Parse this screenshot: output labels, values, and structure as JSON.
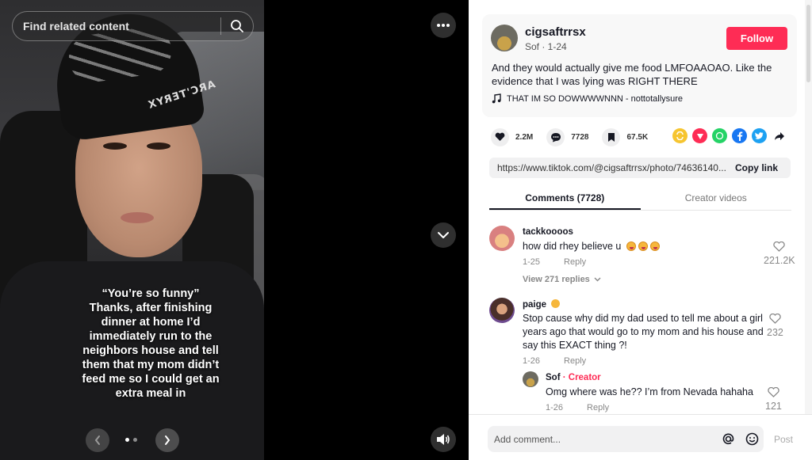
{
  "search": {
    "placeholder": "Find related content"
  },
  "caption": "“You’re so funny”\nThanks, after finishing dinner at home I’d immediately run to the neighbors house and tell them that my mom didn’t feed me so I could get an extra meal in",
  "photo": {
    "brand_text": "ARC'TERYX"
  },
  "carousel": {
    "slide_count": 2,
    "current_slide": 1
  },
  "post": {
    "username": "cigsaftrrsx",
    "display_sub": "Sof · 1-24",
    "follow_label": "Follow",
    "description": "And they would actually give me food LMFOAAOAO. Like the evidence that I was lying was RIGHT THERE",
    "music": "THAT IM SO DOWWWWNNN - nottotallysure"
  },
  "stats": {
    "likes": "2.2M",
    "comments": "7728",
    "saves": "67.5K"
  },
  "share_icons": [
    "repost-icon",
    "send-icon",
    "whatsapp-icon",
    "facebook-icon",
    "twitter-icon",
    "share-arrow-icon"
  ],
  "link": {
    "url": "https://www.tiktok.com/@cigsaftrrsx/photo/74636140...",
    "copy_label": "Copy link"
  },
  "tabs": [
    {
      "label": "Comments (7728)",
      "active": true
    },
    {
      "label": "Creator videos",
      "active": false
    }
  ],
  "comments": [
    {
      "user": "tackkoooos",
      "text": "how did rhey believe u",
      "date": "1-25",
      "reply": "Reply",
      "likes": "221.2K",
      "view_replies": "View 271 replies"
    },
    {
      "user": "paige",
      "text": "Stop cause why did my dad used to tell me about a girl years ago that would go to my mom and his house and say this EXACT thing ?!",
      "date": "1-26",
      "reply": "Reply",
      "likes": "232"
    }
  ],
  "reply": {
    "user": "Sof",
    "badge": "· Creator",
    "text": "Omg where was he?? I’m from Nevada hahaha",
    "date": "1-26",
    "reply": "Reply",
    "likes": "121"
  },
  "footer": {
    "placeholder": "Add comment...",
    "post_label": "Post"
  },
  "colors": {
    "accent": "#fe2c55",
    "creator": "#fe2c55"
  }
}
